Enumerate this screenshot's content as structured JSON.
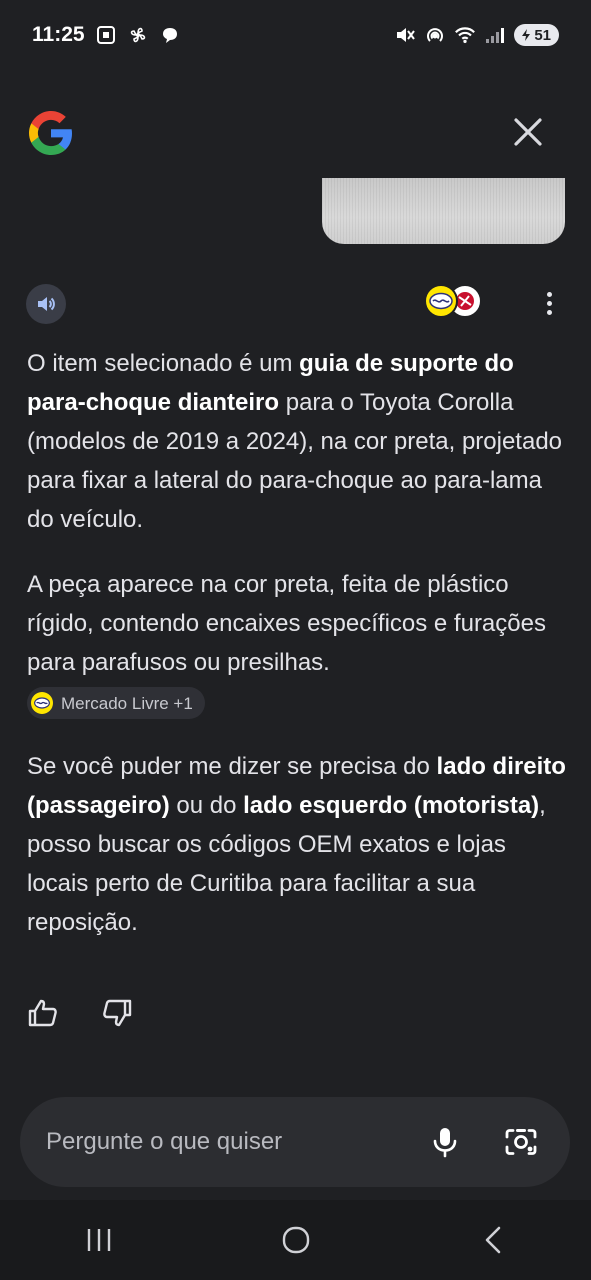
{
  "status_bar": {
    "time": "11:25",
    "battery_level": "51",
    "icons": [
      "screenshot-icon",
      "pinwheel-icon",
      "chat-bubble-icon",
      "mute-icon",
      "hotspot-icon",
      "wifi-icon",
      "signal-icon",
      "battery-icon"
    ]
  },
  "header": {
    "logo_icon": "google-g-logo",
    "close_icon": "close-icon"
  },
  "response": {
    "paragraph1": {
      "part1": "O item selecionado é um ",
      "bold1": "guia de suporte do para-choque dianteiro",
      "part2": " para o Toyota Corolla (modelos de 2019 a 2024), na cor preta, projetado para fixar a lateral do para-choque ao para-lama do veículo."
    },
    "paragraph2": "A peça aparece na cor preta, feita de plástico rígido, contendo encaixes específicos e furações para parafusos ou presilhas.",
    "source_chip": "Mercado Livre +1",
    "paragraph3": {
      "part1": "Se você puder me dizer se precisa do ",
      "bold1": "lado direito (passageiro)",
      "part2": " ou do ",
      "bold2": "lado esquerdo (motorista)",
      "part3": ", posso buscar os códigos OEM exatos e lojas locais perto de Curitiba para facilitar a sua reposição."
    }
  },
  "input": {
    "placeholder": "Pergunte o que quiser"
  },
  "colors": {
    "background": "#1f2023",
    "text": "#e3e3e8",
    "input_bg": "#2c2d31",
    "chip_bg": "#2f3036",
    "mercado_livre_yellow": "#ffe600",
    "speaker_bg": "#3a3d47"
  }
}
